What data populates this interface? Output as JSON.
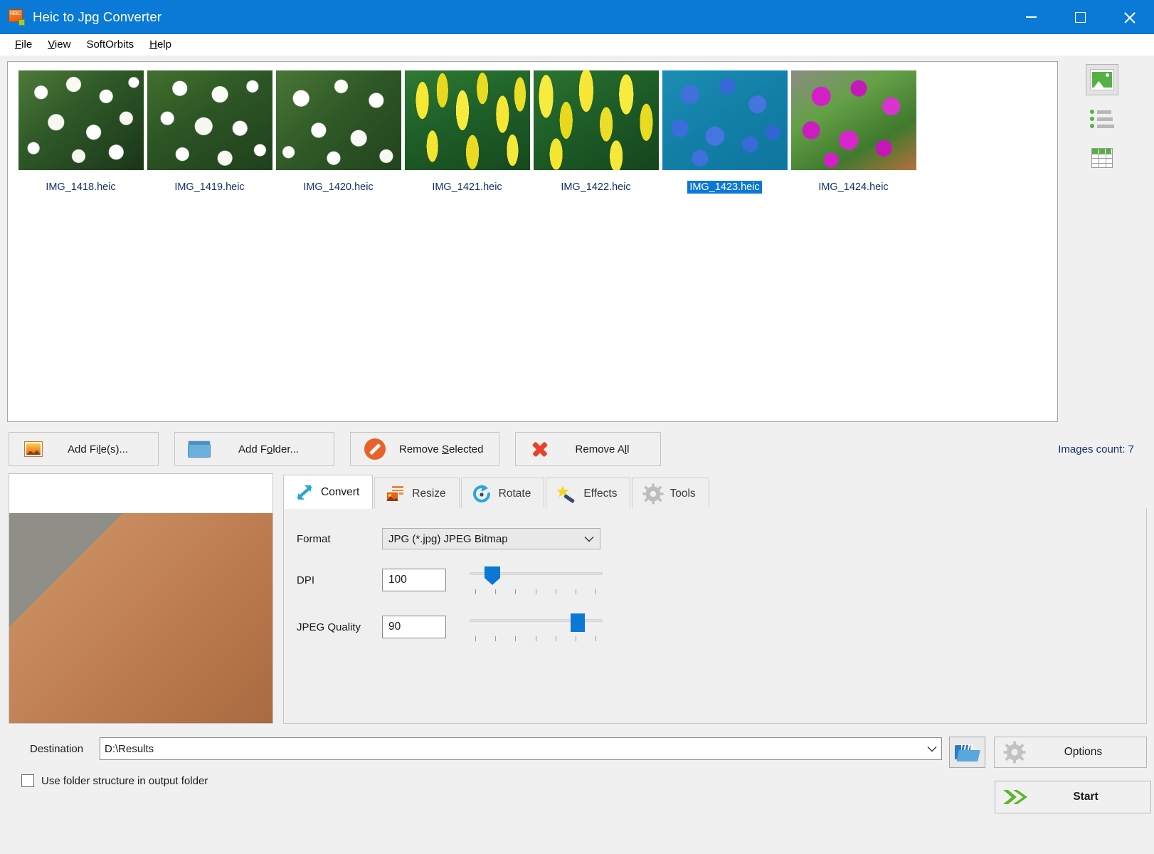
{
  "window": {
    "title": "Heic to Jpg Converter",
    "app_icon": "heic-file-icon",
    "minimize": "minimize-icon",
    "maximize": "maximize-icon",
    "close": "close-icon",
    "titlebar_color": "#0b7ad6"
  },
  "menu": {
    "items": [
      {
        "label": "File",
        "accel": "F"
      },
      {
        "label": "View",
        "accel": "V"
      },
      {
        "label": "SoftOrbits",
        "accel": ""
      },
      {
        "label": "Help",
        "accel": "H"
      }
    ]
  },
  "file_list": {
    "items": [
      {
        "name": "IMG_1418.heic",
        "selected": false,
        "texture": "tex-white"
      },
      {
        "name": "IMG_1419.heic",
        "selected": false,
        "texture": "tex-white-b"
      },
      {
        "name": "IMG_1420.heic",
        "selected": false,
        "texture": "tex-white-c"
      },
      {
        "name": "IMG_1421.heic",
        "selected": false,
        "texture": "tex-yellow"
      },
      {
        "name": "IMG_1422.heic",
        "selected": false,
        "texture": "tex-yellow-b"
      },
      {
        "name": "IMG_1423.heic",
        "selected": true,
        "texture": "tex-purple"
      },
      {
        "name": "IMG_1424.heic",
        "selected": false,
        "texture": "tex-magenta"
      }
    ],
    "selection_color": "#0a78d4"
  },
  "view_modes": [
    {
      "name": "thumbnail-view",
      "icon": "image-icon",
      "active": true
    },
    {
      "name": "list-view",
      "icon": "list-icon",
      "active": false
    },
    {
      "name": "table-view",
      "icon": "table-icon",
      "active": false
    }
  ],
  "actions": {
    "add_files": {
      "label_pre": "Add Fi",
      "accel": "l",
      "label_post": "e(s)...",
      "icon": "image-file-icon"
    },
    "add_folder": {
      "label_pre": "Add F",
      "accel": "o",
      "label_post": "lder...",
      "icon": "folder-icon"
    },
    "remove_selected": {
      "label_pre": "Remove ",
      "accel": "S",
      "label_post": "elected",
      "icon": "no-entry-icon"
    },
    "remove_all": {
      "label_pre": "Remove A",
      "accel": "l",
      "label_post": "l",
      "icon": "red-x-icon"
    },
    "images_count": "Images count: 7"
  },
  "tabs": [
    {
      "label": "Convert",
      "icon": "resize-arrows-icon",
      "active": true
    },
    {
      "label": "Resize",
      "icon": "resize-image-icon",
      "active": false
    },
    {
      "label": "Rotate",
      "icon": "rotate-icon",
      "active": false
    },
    {
      "label": "Effects",
      "icon": "magic-wand-icon",
      "active": false
    },
    {
      "label": "Tools",
      "icon": "gear-icon",
      "active": false
    }
  ],
  "convert_tab": {
    "format": {
      "label": "Format",
      "value": "JPG (*.jpg) JPEG Bitmap"
    },
    "dpi": {
      "label": "DPI",
      "value": "100",
      "slider_percent": 13,
      "ticks": 7
    },
    "jpeg_quality": {
      "label": "JPEG Quality",
      "value": "90",
      "slider_percent": 85,
      "ticks": 7
    },
    "accent_color": "#0a78d4"
  },
  "destination": {
    "label": "Destination",
    "value": "D:\\Results",
    "browse_icon": "open-folder-icon"
  },
  "folder_structure": {
    "label": "Use folder structure in output folder",
    "checked": false
  },
  "buttons": {
    "options": {
      "label": "Options",
      "icon": "gear-icon"
    },
    "start": {
      "label": "Start",
      "icon": "green-arrow-icon"
    }
  }
}
